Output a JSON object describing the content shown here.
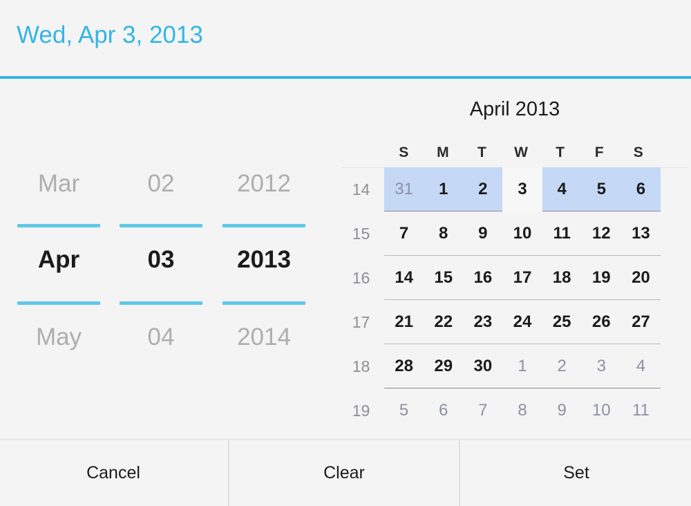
{
  "header": {
    "selected_date_label": "Wed, Apr 3, 2013",
    "accent_color": "#33b5e5"
  },
  "spinners": {
    "month": {
      "prev": "Mar",
      "selected": "Apr",
      "next": "May"
    },
    "day": {
      "prev": "02",
      "selected": "03",
      "next": "04"
    },
    "year": {
      "prev": "2012",
      "selected": "2013",
      "next": "2014"
    }
  },
  "calendar": {
    "title": "April 2013",
    "weekday_headers": [
      "S",
      "M",
      "T",
      "W",
      "T",
      "F",
      "S"
    ],
    "selected_day": 3,
    "highlight_color": "#c5d8f5",
    "weeks": [
      {
        "week_number": "14",
        "highlight": true,
        "rule": "strong",
        "days": [
          {
            "label": "31",
            "in_month": false,
            "selected": false
          },
          {
            "label": "1",
            "in_month": true,
            "selected": false
          },
          {
            "label": "2",
            "in_month": true,
            "selected": false
          },
          {
            "label": "3",
            "in_month": true,
            "selected": true
          },
          {
            "label": "4",
            "in_month": true,
            "selected": false
          },
          {
            "label": "5",
            "in_month": true,
            "selected": false
          },
          {
            "label": "6",
            "in_month": true,
            "selected": false
          }
        ]
      },
      {
        "week_number": "15",
        "highlight": false,
        "rule": "normal",
        "days": [
          {
            "label": "7",
            "in_month": true,
            "selected": false
          },
          {
            "label": "8",
            "in_month": true,
            "selected": false
          },
          {
            "label": "9",
            "in_month": true,
            "selected": false
          },
          {
            "label": "10",
            "in_month": true,
            "selected": false
          },
          {
            "label": "11",
            "in_month": true,
            "selected": false
          },
          {
            "label": "12",
            "in_month": true,
            "selected": false
          },
          {
            "label": "13",
            "in_month": true,
            "selected": false
          }
        ]
      },
      {
        "week_number": "16",
        "highlight": false,
        "rule": "normal",
        "days": [
          {
            "label": "14",
            "in_month": true,
            "selected": false
          },
          {
            "label": "15",
            "in_month": true,
            "selected": false
          },
          {
            "label": "16",
            "in_month": true,
            "selected": false
          },
          {
            "label": "17",
            "in_month": true,
            "selected": false
          },
          {
            "label": "18",
            "in_month": true,
            "selected": false
          },
          {
            "label": "19",
            "in_month": true,
            "selected": false
          },
          {
            "label": "20",
            "in_month": true,
            "selected": false
          }
        ]
      },
      {
        "week_number": "17",
        "highlight": false,
        "rule": "normal",
        "days": [
          {
            "label": "21",
            "in_month": true,
            "selected": false
          },
          {
            "label": "22",
            "in_month": true,
            "selected": false
          },
          {
            "label": "23",
            "in_month": true,
            "selected": false
          },
          {
            "label": "24",
            "in_month": true,
            "selected": false
          },
          {
            "label": "25",
            "in_month": true,
            "selected": false
          },
          {
            "label": "26",
            "in_month": true,
            "selected": false
          },
          {
            "label": "27",
            "in_month": true,
            "selected": false
          }
        ]
      },
      {
        "week_number": "18",
        "highlight": false,
        "rule": "strong",
        "days": [
          {
            "label": "28",
            "in_month": true,
            "selected": false
          },
          {
            "label": "29",
            "in_month": true,
            "selected": false
          },
          {
            "label": "30",
            "in_month": true,
            "selected": false
          },
          {
            "label": "1",
            "in_month": false,
            "selected": false
          },
          {
            "label": "2",
            "in_month": false,
            "selected": false
          },
          {
            "label": "3",
            "in_month": false,
            "selected": false
          },
          {
            "label": "4",
            "in_month": false,
            "selected": false
          }
        ]
      },
      {
        "week_number": "19",
        "highlight": false,
        "rule": "none",
        "days": [
          {
            "label": "5",
            "in_month": false,
            "selected": false
          },
          {
            "label": "6",
            "in_month": false,
            "selected": false
          },
          {
            "label": "7",
            "in_month": false,
            "selected": false
          },
          {
            "label": "8",
            "in_month": false,
            "selected": false
          },
          {
            "label": "9",
            "in_month": false,
            "selected": false
          },
          {
            "label": "10",
            "in_month": false,
            "selected": false
          },
          {
            "label": "11",
            "in_month": false,
            "selected": false
          }
        ]
      }
    ]
  },
  "buttons": {
    "cancel": "Cancel",
    "clear": "Clear",
    "set": "Set"
  }
}
